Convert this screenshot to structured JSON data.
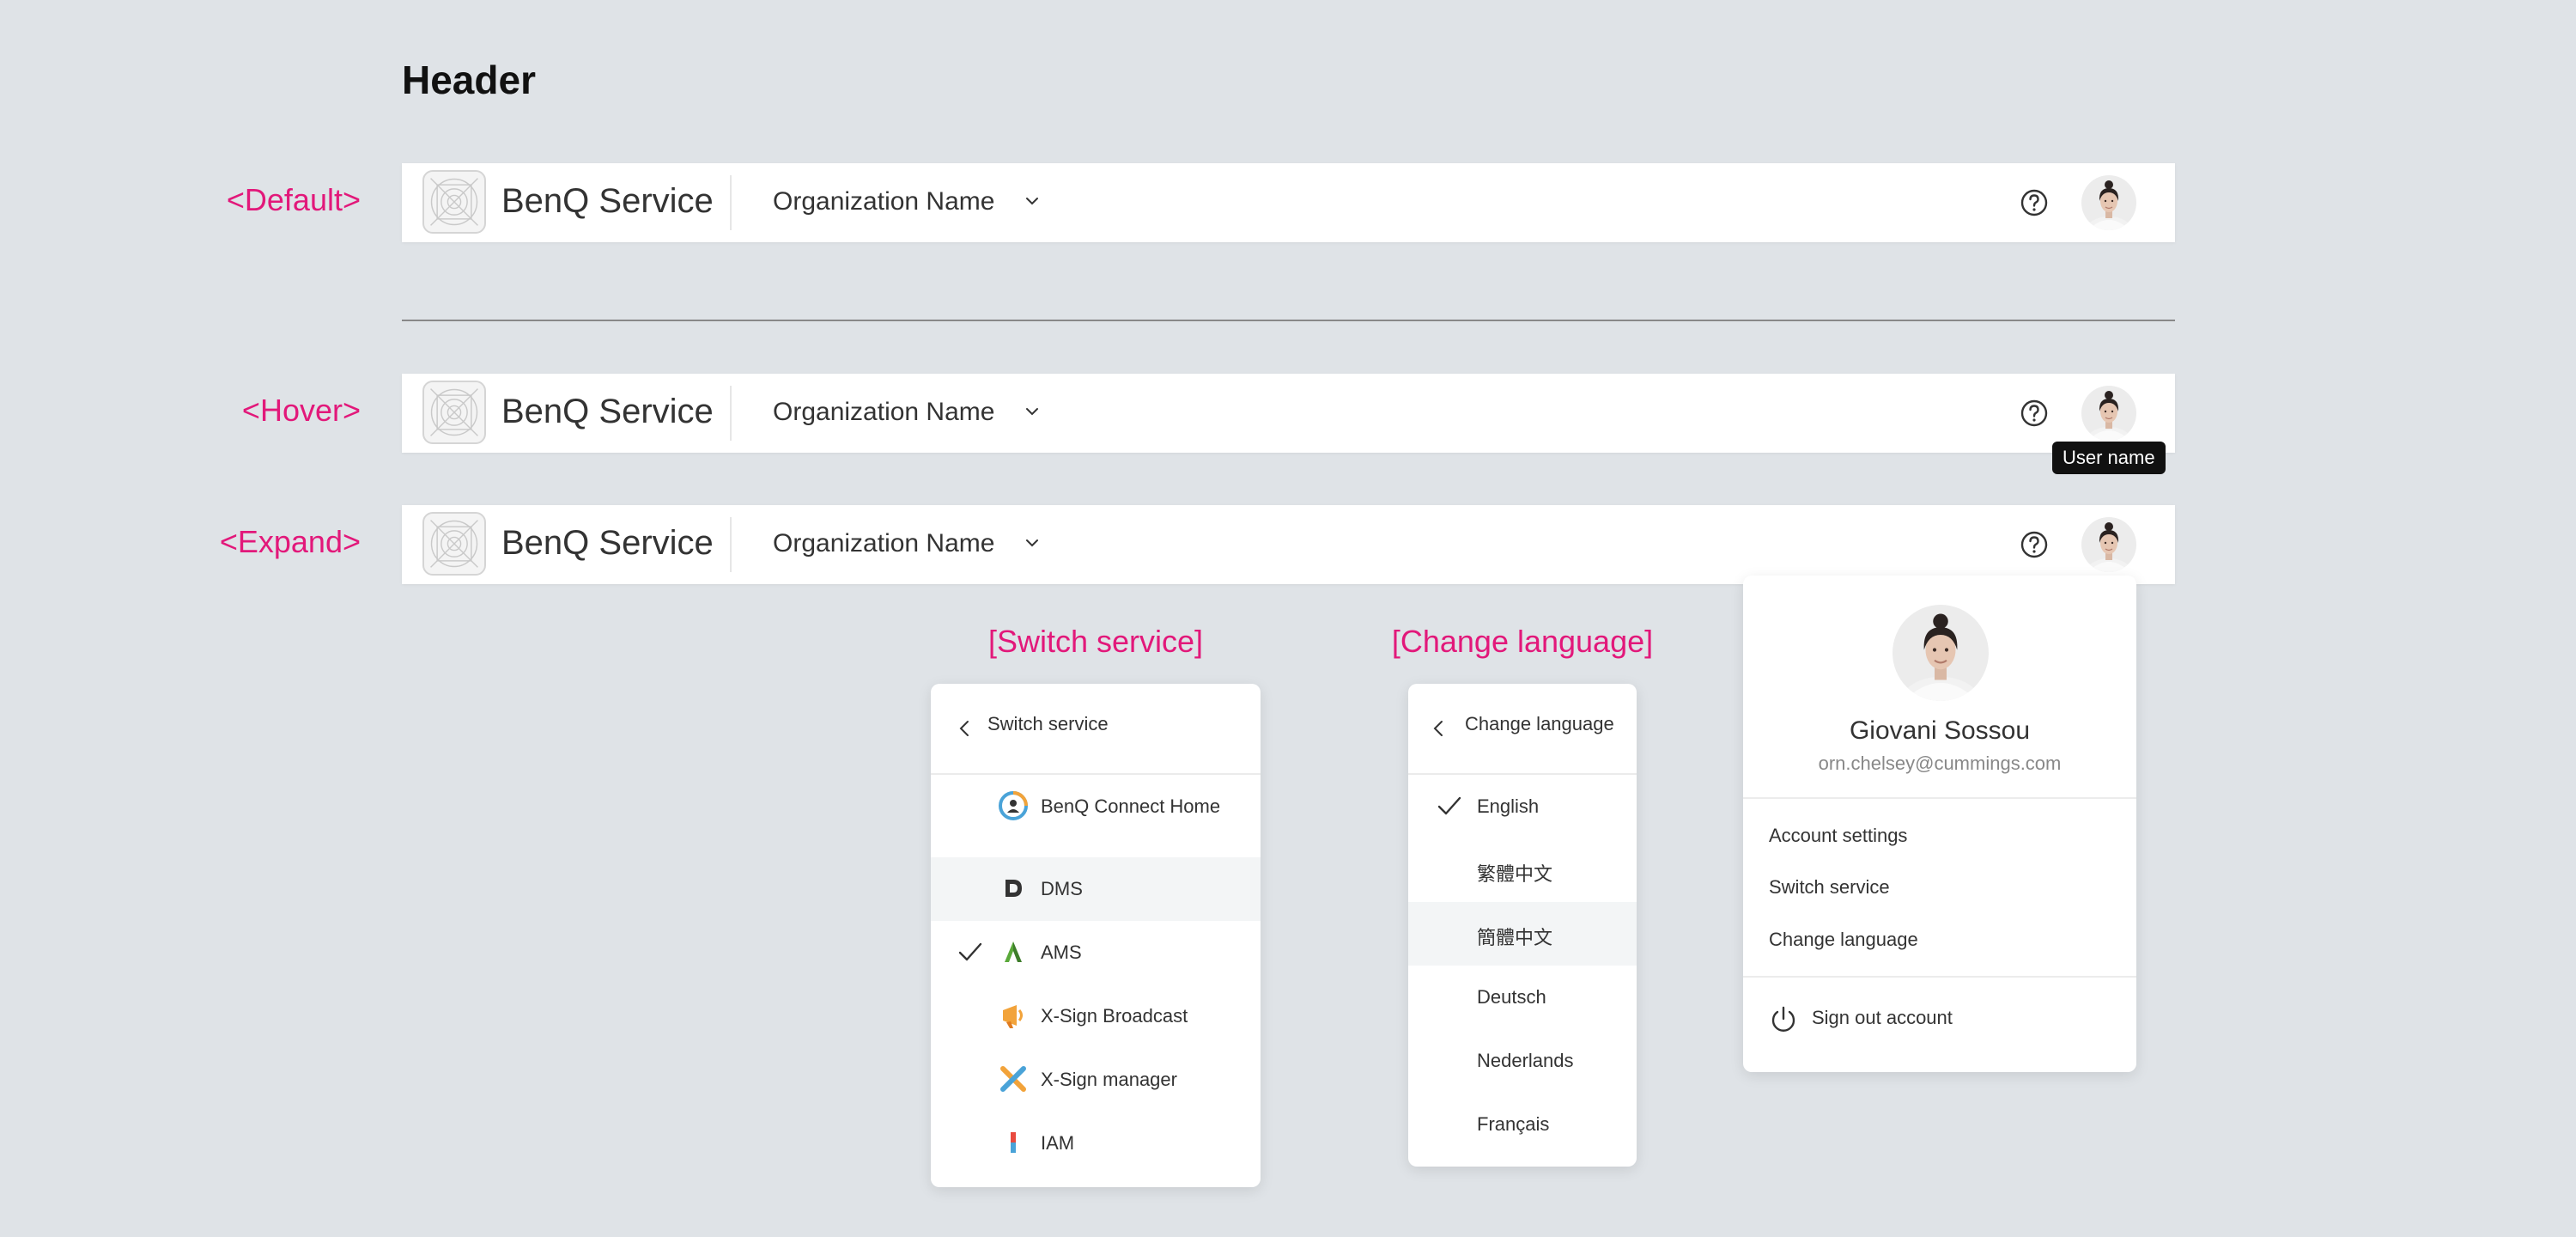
{
  "page": {
    "title": "Header"
  },
  "states": {
    "default": "<Default>",
    "hover": "<Hover>",
    "expand": "<Expand>"
  },
  "header": {
    "brand": "BenQ Service",
    "org_name": "Organization Name",
    "logo_icon": "placeholder-logo-icon",
    "help_icon": "help-circle-icon",
    "chevron_icon": "chevron-down-icon"
  },
  "tooltip": {
    "text": "User name"
  },
  "switch_service": {
    "section_label": "[Switch service]",
    "title": "Switch service",
    "items": [
      {
        "label": "BenQ Connect Home",
        "icon": "benq-connect-home-icon",
        "selected": false
      },
      {
        "label": "DMS",
        "icon": "dms-icon",
        "selected": false,
        "highlighted": true
      },
      {
        "label": "AMS",
        "icon": "ams-icon",
        "selected": true
      },
      {
        "label": "X-Sign Broadcast",
        "icon": "xsign-broadcast-icon",
        "selected": false
      },
      {
        "label": "X-Sign manager",
        "icon": "xsign-manager-icon",
        "selected": false
      },
      {
        "label": "IAM",
        "icon": "iam-icon",
        "selected": false
      }
    ]
  },
  "change_language": {
    "section_label": "[Change language]",
    "title": "Change language",
    "items": [
      {
        "label": "English",
        "selected": true
      },
      {
        "label": "繁體中文",
        "selected": false
      },
      {
        "label": "簡體中文",
        "selected": false,
        "highlighted": true
      },
      {
        "label": "Deutsch",
        "selected": false
      },
      {
        "label": "Nederlands",
        "selected": false
      },
      {
        "label": "Français",
        "selected": false
      }
    ]
  },
  "profile": {
    "name": "Giovani Sossou",
    "email": "orn.chelsey@cummings.com",
    "menu": [
      "Account settings",
      "Switch service",
      "Change language"
    ],
    "sign_out": "Sign out account",
    "sign_out_icon": "power-icon"
  },
  "colors": {
    "accent_label": "#e2187a",
    "background": "#dfe3e7"
  }
}
